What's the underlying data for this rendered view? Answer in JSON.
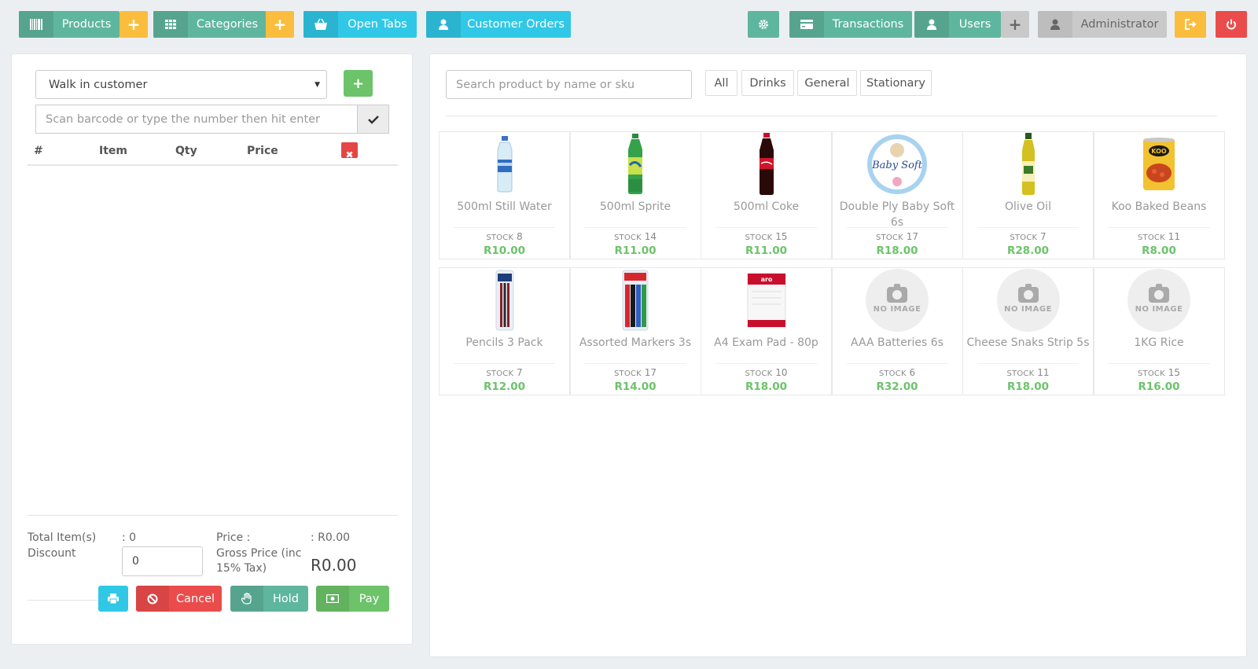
{
  "topbar": {
    "products": "Products",
    "categories": "Categories",
    "open_tabs": "Open Tabs",
    "customer_orders": "Customer Orders",
    "transactions": "Transactions",
    "users": "Users",
    "admin": "Administrator",
    "plus": "+"
  },
  "cart": {
    "customer": "Walk in customer",
    "scan_placeholder": "Scan barcode or type the number then hit enter",
    "headers": [
      "#",
      "Item",
      "Qty",
      "Price"
    ],
    "total_items_label": "Total Item(s)",
    "total_items_value": ": 0",
    "discount_label": "Discount",
    "discount_value": "0",
    "price_label": "Price :",
    "price_value": ": R0.00",
    "gross_label_1": "Gross Price (inc",
    "gross_label_2": "15% Tax)",
    "gross_value": "R0.00",
    "cancel": "Cancel",
    "hold": "Hold",
    "pay": "Pay"
  },
  "catalog": {
    "search_placeholder": "Search product by name or sku",
    "categories": [
      "All",
      "Drinks",
      "General",
      "Stationary"
    ],
    "stock_label": "STOCK",
    "no_image": "NO IMAGE",
    "products": [
      {
        "name": "500ml Still Water",
        "stock": "8",
        "price": "R10.00",
        "img": "water"
      },
      {
        "name": "500ml Sprite",
        "stock": "14",
        "price": "R11.00",
        "img": "sprite"
      },
      {
        "name": "500ml Coke",
        "stock": "15",
        "price": "R11.00",
        "img": "coke"
      },
      {
        "name": "Double Ply Baby Soft 6s",
        "stock": "17",
        "price": "R18.00",
        "img": "babysoft"
      },
      {
        "name": "Olive Oil",
        "stock": "7",
        "price": "R28.00",
        "img": "oil"
      },
      {
        "name": "Koo Baked Beans",
        "stock": "11",
        "price": "R8.00",
        "img": "beans"
      },
      {
        "name": "Pencils 3 Pack",
        "stock": "7",
        "price": "R12.00",
        "img": "pencils"
      },
      {
        "name": "Assorted Markers 3s",
        "stock": "17",
        "price": "R14.00",
        "img": "markers"
      },
      {
        "name": "A4 Exam Pad - 80p",
        "stock": "10",
        "price": "R18.00",
        "img": "pad"
      },
      {
        "name": "AAA Batteries 6s",
        "stock": "6",
        "price": "R32.00",
        "img": "none"
      },
      {
        "name": "Cheese Snaks Strip 5s",
        "stock": "11",
        "price": "R18.00",
        "img": "none"
      },
      {
        "name": "1KG Rice",
        "stock": "15",
        "price": "R16.00",
        "img": "none"
      }
    ]
  },
  "colors": {
    "teal": "#5fb69e",
    "cyan": "#30c8e6",
    "yellow": "#fbbd3e",
    "red": "#ea4c4c",
    "green": "#6cc36a"
  }
}
